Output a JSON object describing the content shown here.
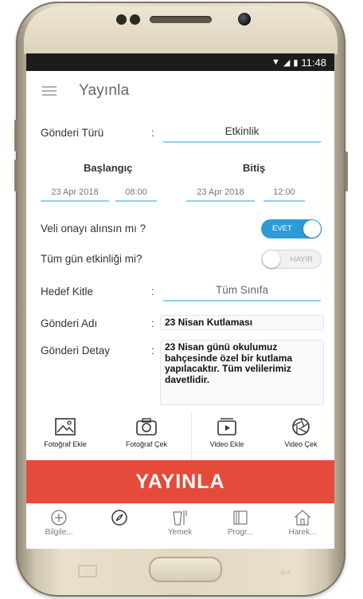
{
  "statusbar": {
    "time": "11:48",
    "wifi_icon": "wifi-icon",
    "signal_icon": "signal-icon",
    "battery_icon": "battery-icon"
  },
  "appbar": {
    "title": "Yayınla",
    "menu_icon": "hamburger-icon"
  },
  "form": {
    "type_label": "Gönderi Türü",
    "type_value": "Etkinlik",
    "start_label": "Başlangıç",
    "end_label": "Bitiş",
    "start_date": "23 Apr 2018",
    "start_time": "08:00",
    "end_date": "23 Apr 2018",
    "end_time": "12:00",
    "parent_approval_label": "Veli onayı alınsın mı ?",
    "parent_approval_value": "EVET",
    "all_day_label": "Tüm gün etkinliği mi?",
    "all_day_value": "HAYIR",
    "audience_label": "Hedef Kitle",
    "audience_value": "Tüm Sınıfa",
    "name_label": "Gönderi Adı",
    "name_value": "23 Nisan Kutlaması",
    "detail_label": "Gönderi Detay",
    "detail_value": "23 Nisan günü okulumuz bahçesinde özel bir kutlama yapılacaktır. Tüm velilerimiz davetlidir.",
    "colon": ":"
  },
  "media": {
    "add_photo": "Fotoğraf Ekle",
    "take_photo": "Fotoğraf Çek",
    "add_video": "Video Ekle",
    "take_video": "Video Çek"
  },
  "publish_button": "YAYINLA",
  "nav": [
    {
      "label": "Bilgile...",
      "icon": "plus-circle-icon"
    },
    {
      "label": "",
      "icon": "compass-icon"
    },
    {
      "label": "Yemek",
      "icon": "food-icon"
    },
    {
      "label": "Progr...",
      "icon": "book-icon"
    },
    {
      "label": "Harek...",
      "icon": "home-icon"
    }
  ],
  "colors": {
    "accent": "#2f9bd6",
    "publish": "#e44b3a",
    "underline": "#8fd0ec"
  }
}
